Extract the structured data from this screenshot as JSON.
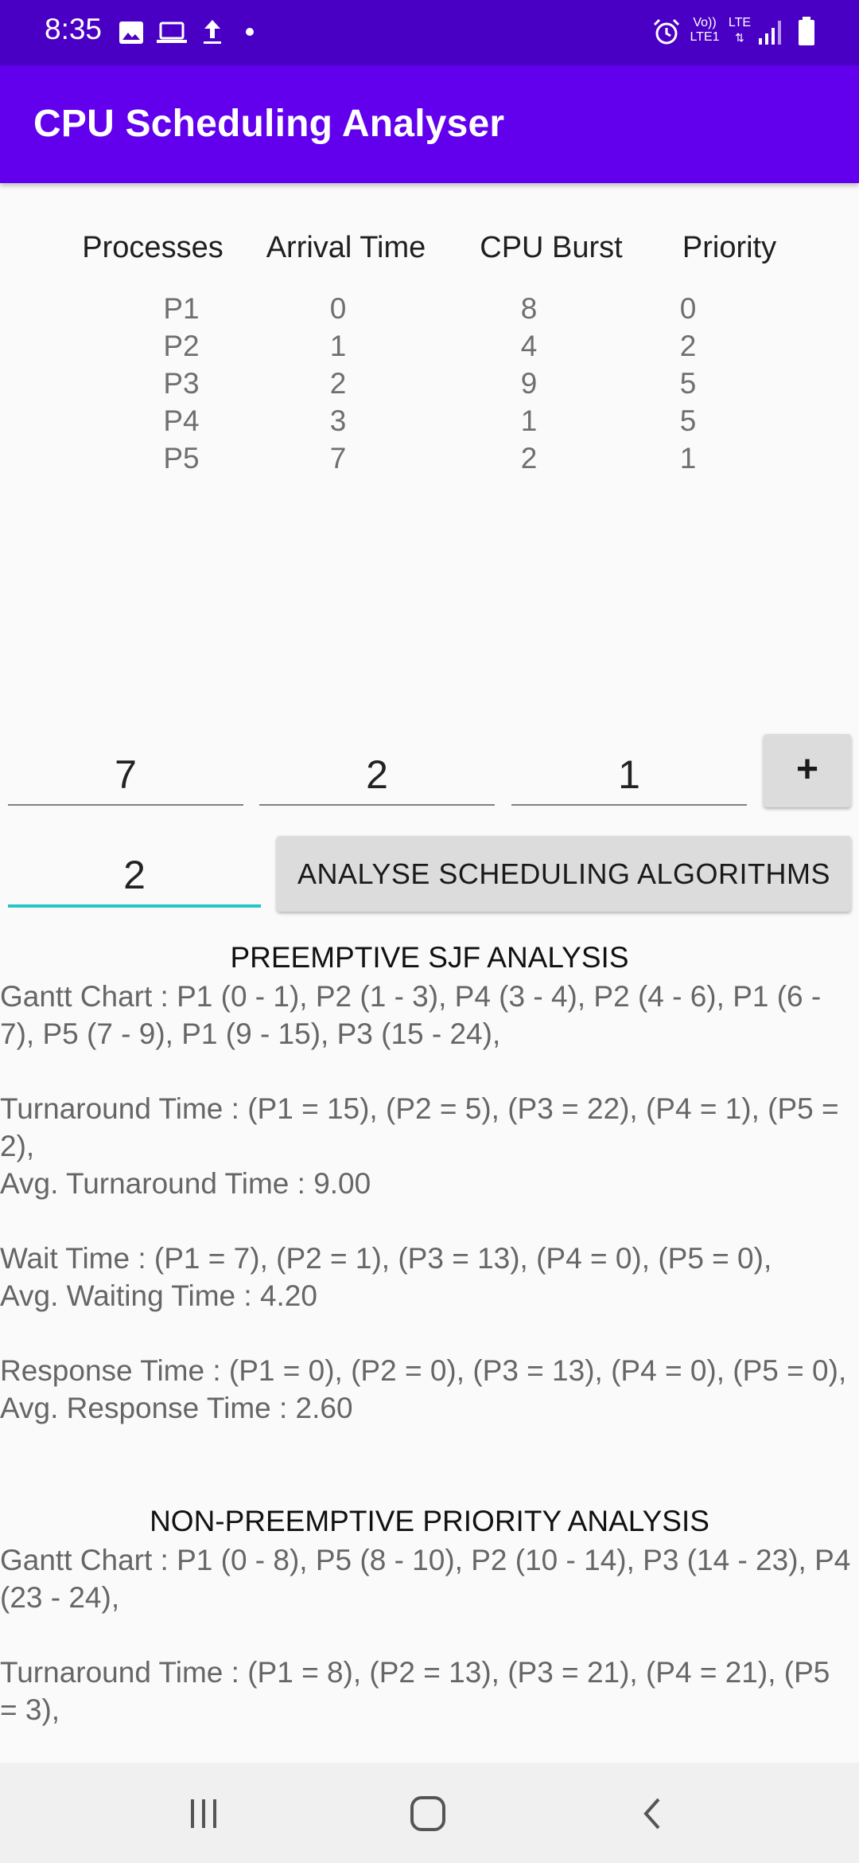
{
  "status_bar": {
    "time": "8:35",
    "icons": [
      "image-icon",
      "laptop-icon",
      "upload-icon",
      "dot-icon",
      "alarm-icon",
      "volte-icon",
      "lte-icon",
      "signal-icon",
      "battery-icon"
    ],
    "volte_label": "Vo))",
    "lte1_label": "LTE1",
    "lte_label": "LTE"
  },
  "app_bar": {
    "title": "CPU Scheduling Analyser",
    "color": "#6200ee"
  },
  "table": {
    "headers": [
      "Processes",
      "Arrival Time",
      "CPU Burst",
      "Priority"
    ],
    "processes": [
      "P1",
      "P2",
      "P3",
      "P4",
      "P5"
    ],
    "arrival": [
      "0",
      "1",
      "2",
      "3",
      "7"
    ],
    "burst": [
      "8",
      "4",
      "9",
      "1",
      "2"
    ],
    "priority": [
      "0",
      "2",
      "5",
      "5",
      "1"
    ]
  },
  "inputs": {
    "arrival_value": "7",
    "burst_value": "2",
    "priority_value": "1",
    "quantum_value": "2"
  },
  "buttons": {
    "add_label": "+",
    "analyse_label": "ANALYSE SCHEDULING ALGORITHMS"
  },
  "results": {
    "sjf": {
      "title": "PREEMPTIVE SJF ANALYSIS",
      "gantt": "Gantt Chart :  P1 (0 - 1),  P2 (1 - 3),  P4 (3 - 4),  P2 (4 - 6),  P1 (6 - 7),  P5 (7 - 9),  P1 (9 - 15),  P3 (15 - 24),",
      "turnaround": "Turnaround Time : (P1 = 15), (P2 = 5), (P3 = 22), (P4 = 1), (P5 = 2),",
      "avg_turnaround": "Avg. Turnaround Time : 9.00",
      "wait": "Wait Time : (P1 = 7), (P2 = 1), (P3 = 13), (P4 = 0), (P5 = 0),",
      "avg_wait": "Avg. Waiting Time : 4.20",
      "response": "Response Time : (P1 = 0), (P2 = 0), (P3 = 13), (P4 = 0), (P5 = 0),",
      "avg_response": "Avg. Response Time : 2.60"
    },
    "priority": {
      "title": "NON-PREEMPTIVE PRIORITY ANALYSIS",
      "gantt": "Gantt Chart :  P1 (0 - 8),  P5 (8 - 10),  P2 (10 - 14),  P3 (14 - 23),  P4 (23 - 24),",
      "turnaround": "Turnaround Time : (P1 = 8), (P2 = 13), (P3 = 21), (P4 = 21), (P5 = 3),"
    }
  },
  "nav_bar": {
    "icons": [
      "recents-icon",
      "home-icon",
      "back-icon"
    ]
  }
}
